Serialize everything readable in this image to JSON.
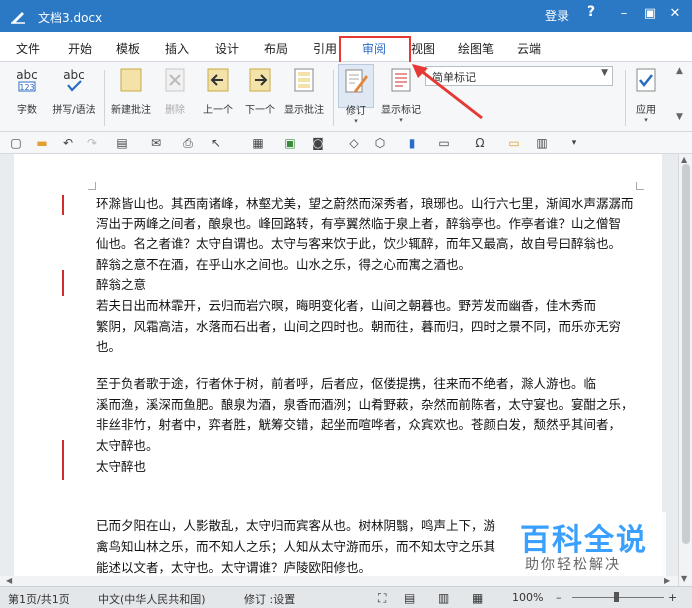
{
  "window": {
    "title": "文档3.docx",
    "login": "登录",
    "help": "?",
    "minimize": "–",
    "restore": "▣",
    "close": "✕"
  },
  "menu": {
    "tabs": [
      "文件",
      "开始",
      "模板",
      "插入",
      "设计",
      "布局",
      "引用",
      "审阅",
      "视图",
      "绘图笔",
      "云端"
    ],
    "active": "审阅"
  },
  "ribbon": {
    "wordcount": "字数",
    "spellcheck": "拼写/语法",
    "new_comment": "新建批注",
    "delete": "删除",
    "prev": "上一个",
    "next": "下一个",
    "show_comments": "显示批注",
    "track": "修订",
    "show_markup": "显示标记",
    "markup_select": "简单标记",
    "apply": "应用"
  },
  "document": {
    "lines": [
      "环滁皆山也。其西南诸峰，林壑尤美，望之蔚然而深秀者，琅琊也。山行六七里，渐闻水声潺潺而",
      "泻出于两峰之间者，酿泉也。峰回路转，有亭翼然临于泉上者，醉翁亭也。作亭者谁？山之僧智",
      "仙也。名之者谁？太守自谓也。太守与客来饮于此，饮少辄醉，而年又最高，故自号曰醉翁也。",
      "醉翁之意不在酒，在乎山水之间也。山水之乐，得之心而寓之酒也。",
      "醉翁之意",
      "    若夫日出而林霏开，云归而岩穴暝，晦明变化者，山间之朝暮也。野芳发而幽香，佳木秀而",
      "繁阴，风霜高洁，水落而石出者，山间之四时也。朝而往，暮而归，四时之景不同，而乐亦无穷",
      "也。",
      "",
      "    至于负者歌于途，行者休于树，前者呼，后者应，伛偻提携，往来而不绝者，滁人游也。临",
      "溪而渔，溪深而鱼肥。酿泉为酒，泉香而酒洌；山肴野蔌，杂然而前陈者，太守宴也。宴酣之乐，",
      "非丝非竹，射者中，弈者胜，觥筹交错，起坐而喧哗者，众宾欢也。苍颜白发，颓然乎其间者，",
      "太守醉也。",
      "太守醉也",
      "",
      "",
      "    已而夕阳在山，人影散乱，太守归而宾客从也。树林阴翳，鸣声上下，游",
      "禽鸟知山林之乐，而不知人之乐；人知从太守游而乐，而不知太守之乐其",
      "能述以文者，太守也。太守谓谁？庐陵欧阳修也。"
    ]
  },
  "status": {
    "page": "第1页/共1页",
    "language": "中文(中华人民共和国)",
    "track_status": "修订 :设置",
    "zoom": "100%"
  },
  "watermark": {
    "big": "百科全说",
    "small": "助你轻松解决"
  },
  "colors": {
    "title_bar": "#2b78c5",
    "accent": "#2b6cc4",
    "highlight": "#e53935",
    "revision_mark": "#d62b2b"
  }
}
